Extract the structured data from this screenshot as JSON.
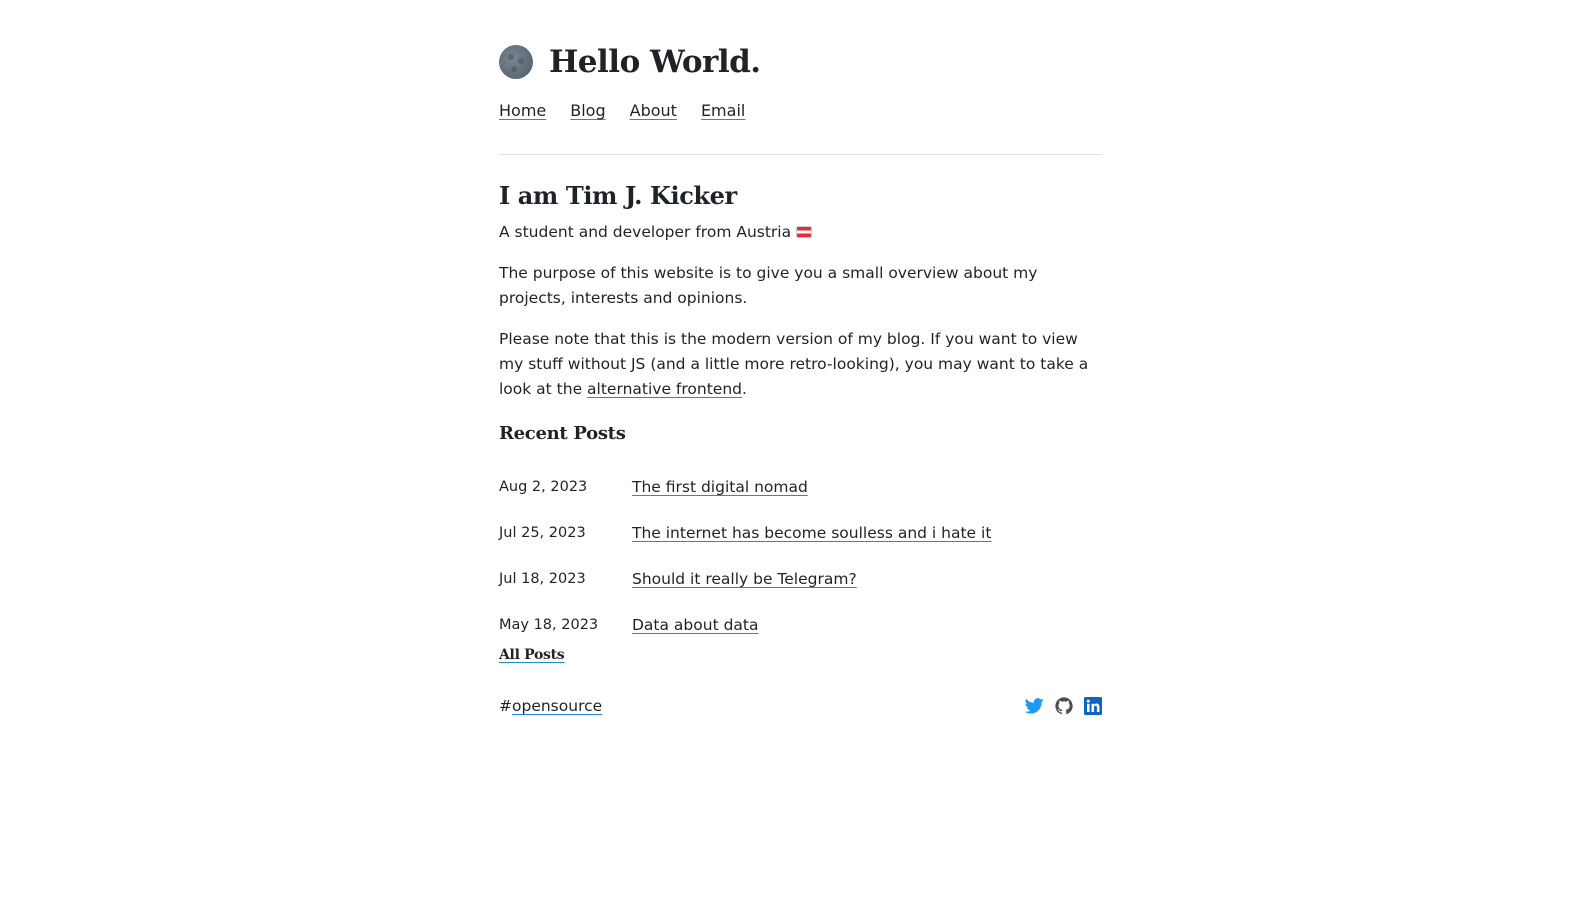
{
  "header": {
    "title": "Hello World."
  },
  "nav": {
    "items": [
      {
        "label": "Home"
      },
      {
        "label": "Blog"
      },
      {
        "label": "About"
      },
      {
        "label": "Email"
      }
    ]
  },
  "intro": {
    "title": "I am Tim J. Kicker",
    "subtitle": "A student and developer from Austria",
    "subtitle_flag_icon": "austria-flag-icon",
    "paragraph1": "The purpose of this website is to give you a small overview about my projects, interests and opinions.",
    "paragraph2_before": "Please note that this is the modern version of my blog. If you want to view my stuff without JS (and a little more retro-looking), you may want to take a look at the ",
    "paragraph2_link": "alternative frontend",
    "paragraph2_after": "."
  },
  "recent": {
    "heading": "Recent Posts",
    "posts": [
      {
        "date": "Aug 2, 2023",
        "title": "The first digital nomad"
      },
      {
        "date": "Jul 25, 2023",
        "title": "The internet has become soulless and i hate it"
      },
      {
        "date": "Jul 18, 2023",
        "title": "Should it really be Telegram?"
      },
      {
        "date": "May 18, 2023",
        "title": "Data about data"
      }
    ],
    "all_posts_label": "All Posts"
  },
  "footer": {
    "hash": "#",
    "tag": "opensource",
    "socials": [
      {
        "icon": "twitter-icon",
        "color": "#1d9bf0"
      },
      {
        "icon": "github-icon",
        "color": "#4a4f55"
      },
      {
        "icon": "linkedin-icon",
        "color": "#0a66c2"
      }
    ]
  },
  "colors": {
    "text": "#1f2328",
    "link_underline": "#1e90c8",
    "divider": "#dadde1"
  }
}
